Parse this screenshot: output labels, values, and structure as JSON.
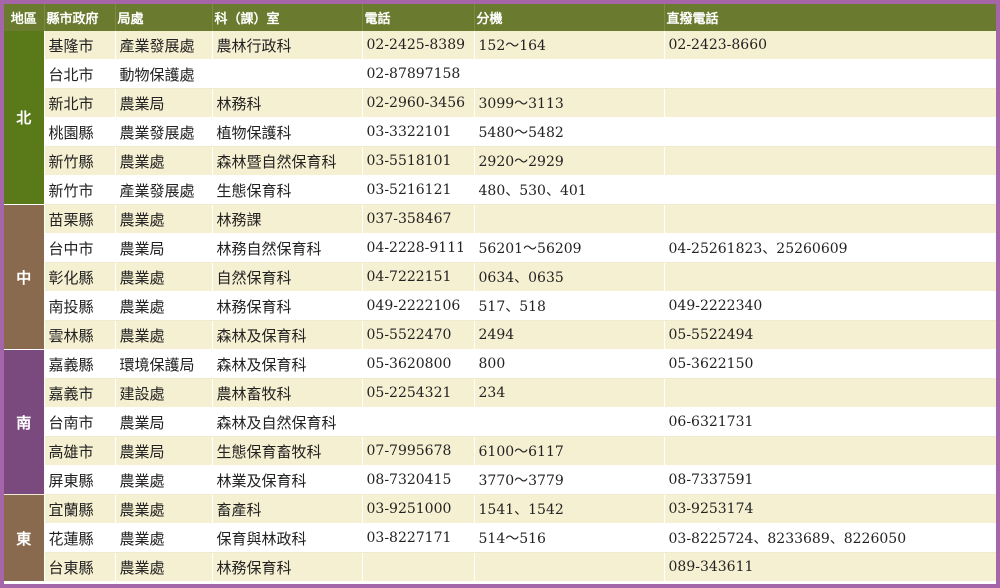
{
  "headers": [
    "地區",
    "縣市政府",
    "局處",
    "科（課）室",
    "電話",
    "分機",
    "直撥電話"
  ],
  "region_colors": {
    "北": "#5a7a1a",
    "中": "#8a6a4e",
    "南": "#7a4a7e",
    "東": "#8a6a4e"
  },
  "regions": [
    {
      "name": "北",
      "rows": [
        {
          "county": "基隆市",
          "bureau": "產業發展處",
          "section": "農林行政科",
          "phone": "02-2425-8389",
          "ext": "152～164",
          "direct": "02-2423-8660"
        },
        {
          "county": "台北市",
          "bureau": "動物保護處",
          "section": "",
          "phone": "02-87897158",
          "ext": "",
          "direct": ""
        },
        {
          "county": "新北市",
          "bureau": "農業局",
          "section": "林務科",
          "phone": "02-2960-3456",
          "ext": "3099～3113",
          "direct": ""
        },
        {
          "county": "桃園縣",
          "bureau": "農業發展處",
          "section": "植物保護科",
          "phone": "03-3322101",
          "ext": "5480～5482",
          "direct": ""
        },
        {
          "county": "新竹縣",
          "bureau": "農業處",
          "section": "森林暨自然保育科",
          "phone": "03-5518101",
          "ext": "2920～2929",
          "direct": ""
        },
        {
          "county": "新竹市",
          "bureau": "產業發展處",
          "section": "生態保育科",
          "phone": "03-5216121",
          "ext": "480、530、401",
          "direct": ""
        }
      ]
    },
    {
      "name": "中",
      "rows": [
        {
          "county": "苗栗縣",
          "bureau": "農業處",
          "section": "林務課",
          "phone": "037-358467",
          "ext": "",
          "direct": ""
        },
        {
          "county": "台中市",
          "bureau": "農業局",
          "section": "林務自然保育科",
          "phone": "04-2228-9111",
          "ext": "56201～56209",
          "direct": "04-25261823、25260609"
        },
        {
          "county": "彰化縣",
          "bureau": "農業處",
          "section": "自然保育科",
          "phone": "04-7222151",
          "ext": "0634、0635",
          "direct": ""
        },
        {
          "county": "南投縣",
          "bureau": "農業處",
          "section": "林務保育科",
          "phone": "049-2222106",
          "ext": "517、518",
          "direct": "049-2222340"
        },
        {
          "county": "雲林縣",
          "bureau": "農業處",
          "section": "森林及保育科",
          "phone": "05-5522470",
          "ext": "2494",
          "direct": "05-5522494"
        }
      ]
    },
    {
      "name": "南",
      "rows": [
        {
          "county": "嘉義縣",
          "bureau": "環境保護局",
          "section": "森林及保育科",
          "phone": "05-3620800",
          "ext": "800",
          "direct": "05-3622150"
        },
        {
          "county": "嘉義市",
          "bureau": "建設處",
          "section": "農林畜牧科",
          "phone": "05-2254321",
          "ext": "234",
          "direct": ""
        },
        {
          "county": "台南市",
          "bureau": "農業局",
          "section": "森林及自然保育科",
          "phone": "",
          "ext": "",
          "direct": "06-6321731"
        },
        {
          "county": "高雄市",
          "bureau": "農業局",
          "section": "生態保育畜牧科",
          "phone": "07-7995678",
          "ext": "6100～6117",
          "direct": ""
        },
        {
          "county": "屏東縣",
          "bureau": "農業處",
          "section": "林業及保育科",
          "phone": "08-7320415",
          "ext": "3770～3779",
          "direct": "08-7337591"
        }
      ]
    },
    {
      "name": "東",
      "rows": [
        {
          "county": "宜蘭縣",
          "bureau": "農業處",
          "section": "畜產科",
          "phone": "03-9251000",
          "ext": "1541、1542",
          "direct": "03-9253174"
        },
        {
          "county": "花蓮縣",
          "bureau": "農業處",
          "section": "保育與林政科",
          "phone": "03-8227171",
          "ext": "514～516",
          "direct": "03-8225724、8233689、8226050"
        },
        {
          "county": "台東縣",
          "bureau": "農業處",
          "section": "林務保育科",
          "phone": "",
          "ext": "",
          "direct": "089-343611"
        }
      ]
    }
  ]
}
